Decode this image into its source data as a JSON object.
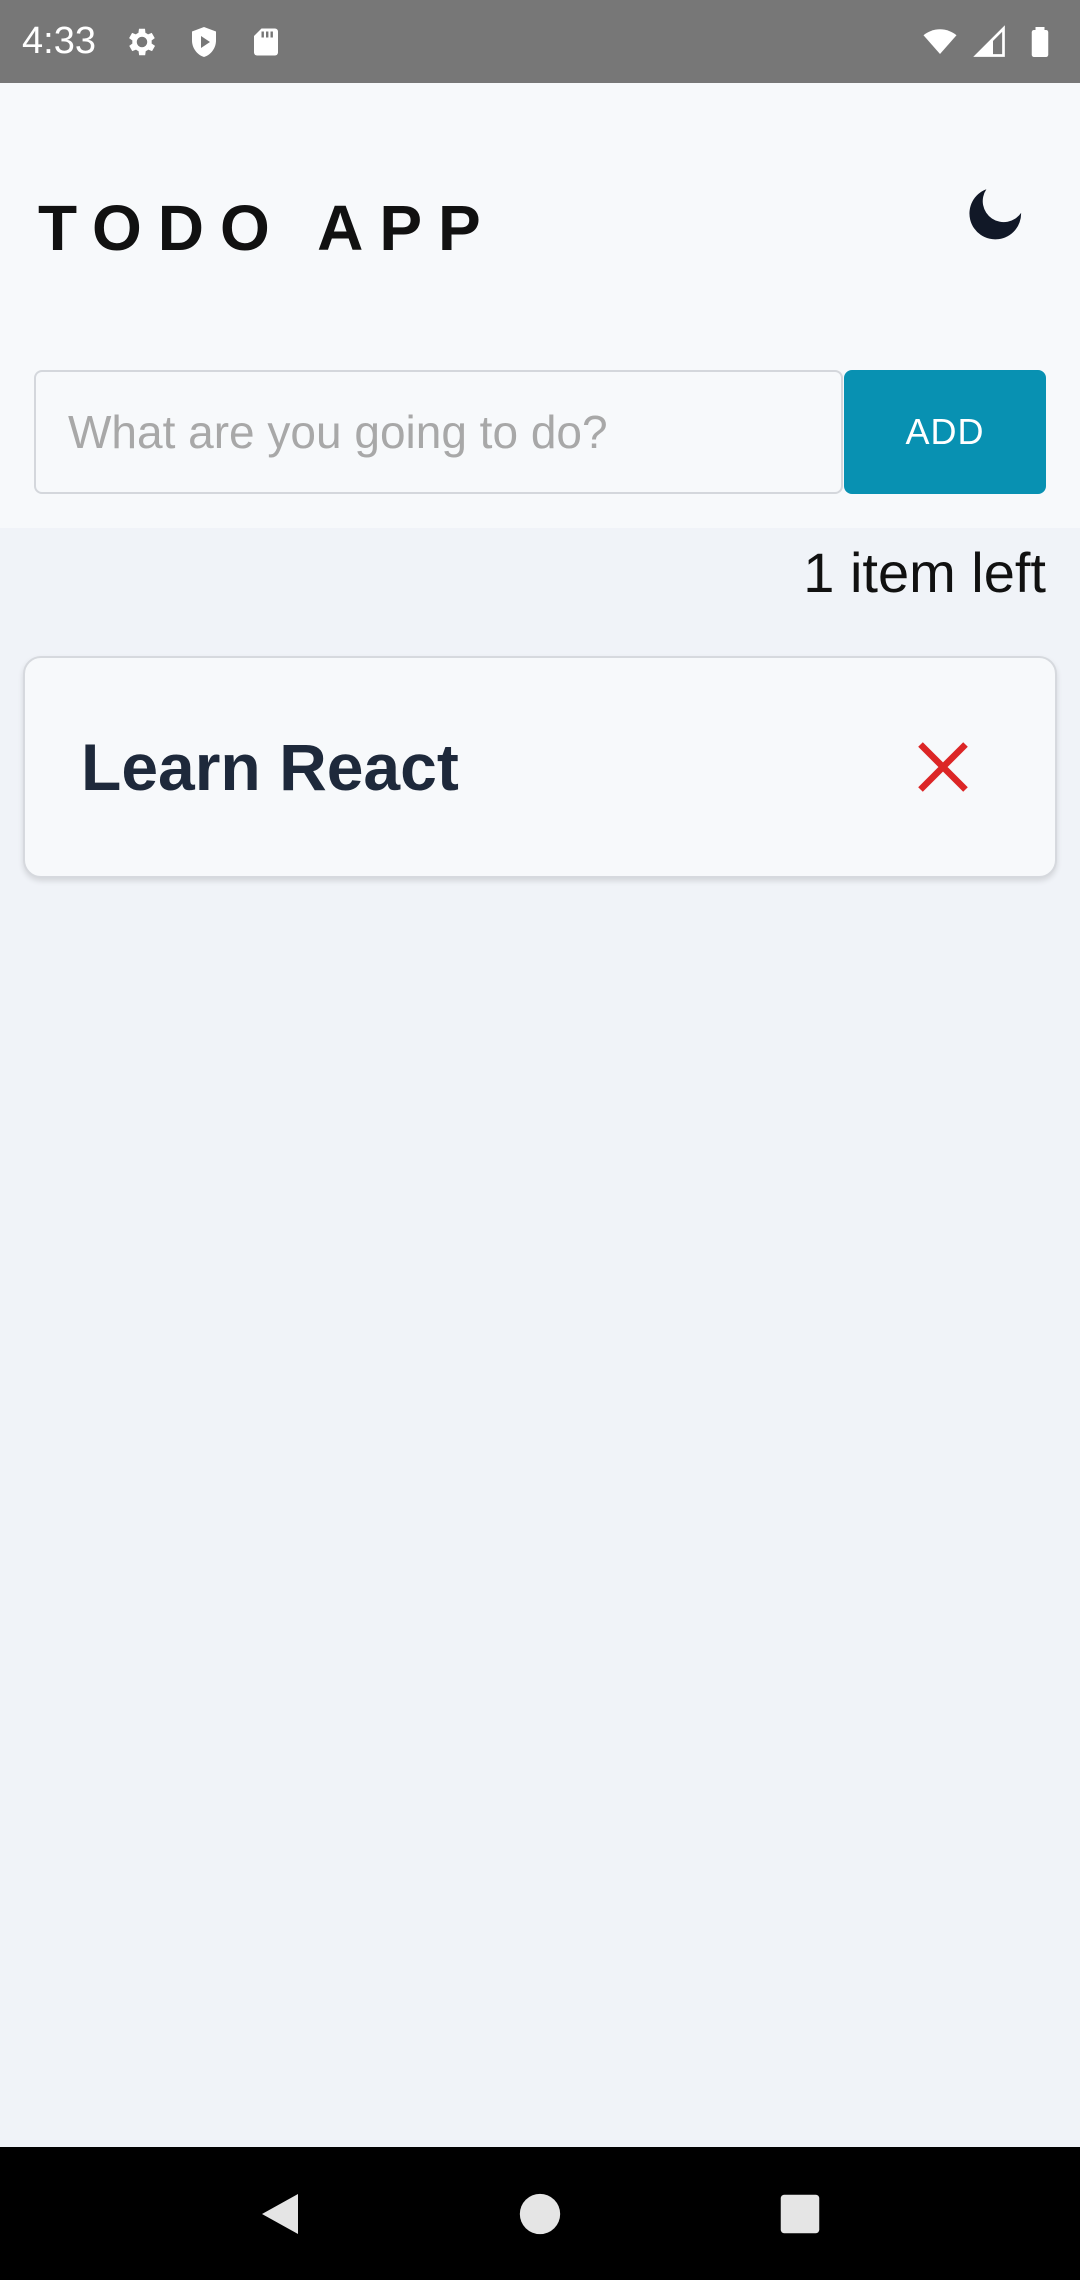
{
  "status_bar": {
    "time": "4:33",
    "icons_left": [
      "gear-icon",
      "shield-play-icon",
      "sd-card-icon"
    ],
    "icons_right": [
      "wifi-icon",
      "signal-icon",
      "battery-icon"
    ]
  },
  "header": {
    "title": "TODO APP",
    "theme_icon": "moon-icon"
  },
  "input": {
    "placeholder": "What are you going to do?",
    "value": ""
  },
  "add_button": {
    "label": "ADD",
    "color": "#0891b2"
  },
  "items_left": "1 item left",
  "todos": [
    {
      "text": "Learn React",
      "delete_icon": "close-icon",
      "delete_color": "#dc2626"
    }
  ],
  "nav_bar": {
    "buttons": [
      "back-icon",
      "home-icon",
      "recents-icon"
    ]
  }
}
